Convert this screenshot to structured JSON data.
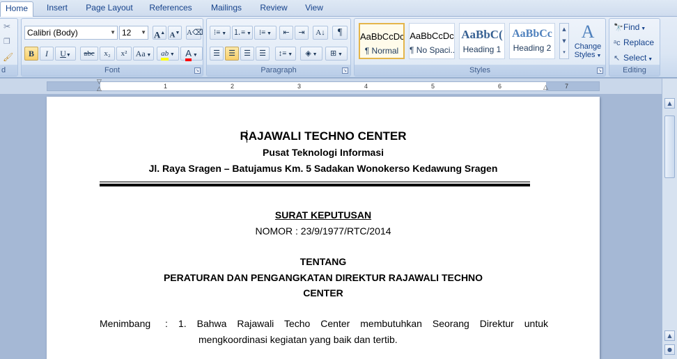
{
  "tabs": [
    {
      "label": "Home",
      "active": true
    },
    {
      "label": "Insert"
    },
    {
      "label": "Page Layout"
    },
    {
      "label": "References"
    },
    {
      "label": "Mailings"
    },
    {
      "label": "Review"
    },
    {
      "label": "View"
    }
  ],
  "clipboard": {
    "label_fragment": "d"
  },
  "font": {
    "label": "Font",
    "family": "Calibri (Body)",
    "size": "12",
    "grow": "A",
    "shrink": "A",
    "bold": "B",
    "italic": "I",
    "underline": "U",
    "strike": "abc",
    "subscript": "x₂",
    "superscript": "x²",
    "change_case": "Aa",
    "highlight": "ab",
    "font_color": "A",
    "highlight_color": "#ffff00",
    "font_color_swatch": "#ff0000"
  },
  "paragraph": {
    "label": "Paragraph",
    "pilcrow": "¶"
  },
  "styles": {
    "label": "Styles",
    "items": [
      {
        "sample": "AaBbCcDc",
        "name": "¶ Normal",
        "selected": true
      },
      {
        "sample": "AaBbCcDc",
        "name": "¶ No Spaci..."
      },
      {
        "sample": "AaBbC(",
        "name": "Heading 1"
      },
      {
        "sample": "AaBbCc",
        "name": "Heading 2"
      }
    ],
    "change_styles_line1": "Change",
    "change_styles_line2": "Styles"
  },
  "editing": {
    "label": "Editing",
    "find": "Find",
    "replace": "Replace",
    "select": "Select"
  },
  "ruler": {
    "numbers": [
      "1",
      "2",
      "3",
      "4",
      "5",
      "6",
      "7"
    ]
  },
  "document": {
    "title": "RAJAWALI TECHNO CENTER",
    "subtitle": "Pusat Teknologi Informasi",
    "address": "Jl. Raya Sragen – Batujamus Km. 5 Sadakan Wonokerso Kedawung Sragen",
    "letter_type": "SURAT KEPUTUSAN",
    "number": "NOMOR : 23/9/1977/RTC/2014",
    "about": "TENTANG",
    "regulation_line1": "PERATURAN DAN PENGANGKATAN DIREKTUR RAJAWALI TECHNO",
    "regulation_line2": "CENTER",
    "considering_label": "Menimbang",
    "considering_colon": ":",
    "considering_item1_line1": "1. Bahwa Rajawali Techo Center membutuhkan Seorang Direktur untuk",
    "considering_item1_line2": "mengkoordinasi kegiatan yang baik dan tertib."
  }
}
